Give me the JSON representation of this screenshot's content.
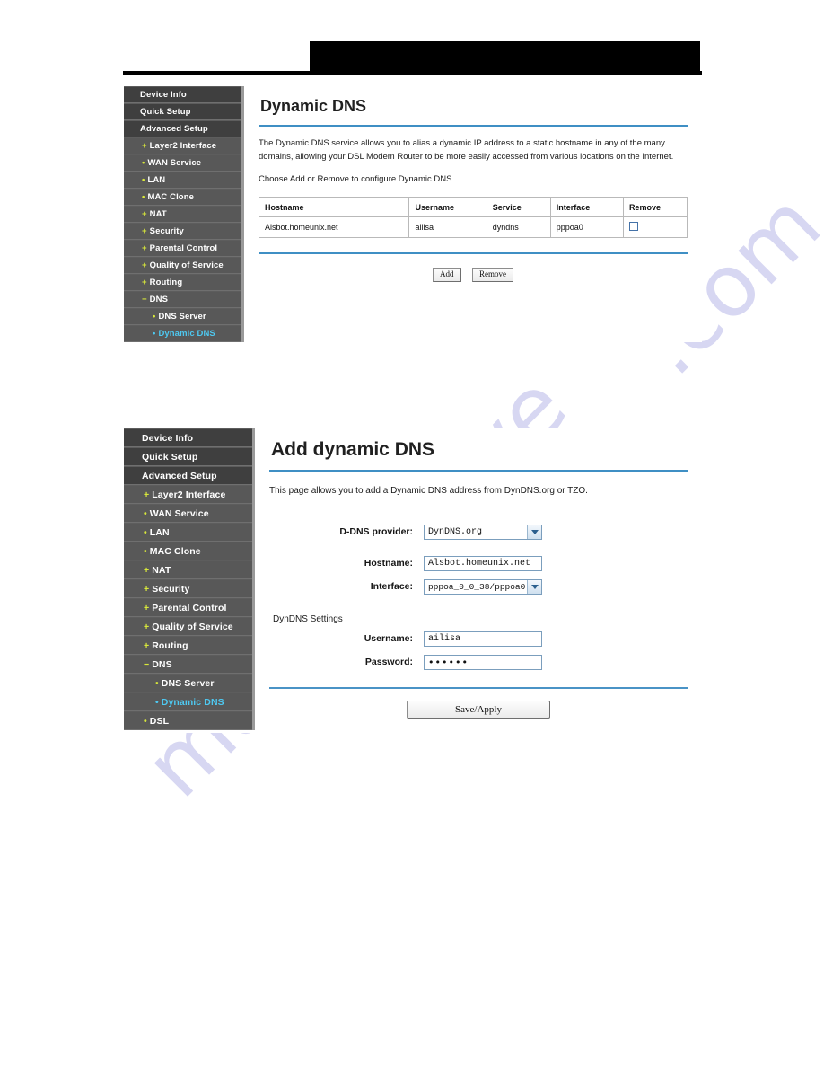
{
  "watermark": {
    "line_a": ".com",
    "line_b": "manualshive"
  },
  "header": {
    "redaction_bar": ""
  },
  "screenshot_top": {
    "sidebar": {
      "items": [
        {
          "label": "Device Info",
          "level": "top",
          "marker": "",
          "active": false
        },
        {
          "label": "Quick Setup",
          "level": "top",
          "marker": "",
          "active": false
        },
        {
          "label": "Advanced Setup",
          "level": "top",
          "marker": "",
          "active": false
        },
        {
          "label": "Layer2 Interface",
          "level": "lvl1",
          "marker": "+",
          "active": false
        },
        {
          "label": "WAN Service",
          "level": "lvl1",
          "marker": "•",
          "active": false
        },
        {
          "label": "LAN",
          "level": "lvl1",
          "marker": "•",
          "active": false
        },
        {
          "label": "MAC Clone",
          "level": "lvl1",
          "marker": "•",
          "active": false
        },
        {
          "label": "NAT",
          "level": "lvl1",
          "marker": "+",
          "active": false
        },
        {
          "label": "Security",
          "level": "lvl1",
          "marker": "+",
          "active": false
        },
        {
          "label": "Parental Control",
          "level": "lvl1",
          "marker": "+",
          "active": false
        },
        {
          "label": "Quality of Service",
          "level": "lvl1",
          "marker": "+",
          "active": false
        },
        {
          "label": "Routing",
          "level": "lvl1",
          "marker": "+",
          "active": false
        },
        {
          "label": "DNS",
          "level": "lvl1",
          "marker": "−",
          "active": false
        },
        {
          "label": "DNS Server",
          "level": "lvl2",
          "marker": "•",
          "active": false
        },
        {
          "label": "Dynamic DNS",
          "level": "lvl2",
          "marker": "•",
          "active": true
        }
      ]
    },
    "title": "Dynamic DNS",
    "paragraph_1": "The Dynamic DNS service allows you to alias a dynamic IP address to a static hostname in any of the many domains, allowing your DSL Modem Router to be more easily accessed from various locations on the Internet.",
    "paragraph_2": "Choose Add or Remove to configure Dynamic DNS.",
    "table": {
      "headers": [
        "Hostname",
        "Username",
        "Service",
        "Interface",
        "Remove"
      ],
      "rows": [
        {
          "hostname": "Alsbot.homeunix.net",
          "username": "ailisa",
          "service": "dyndns",
          "interface": "pppoa0",
          "remove_checked": false
        }
      ]
    },
    "buttons": {
      "add": "Add",
      "remove": "Remove"
    }
  },
  "screenshot_bottom": {
    "sidebar": {
      "items": [
        {
          "label": "Device Info",
          "level": "top",
          "marker": "",
          "active": false
        },
        {
          "label": "Quick Setup",
          "level": "top",
          "marker": "",
          "active": false
        },
        {
          "label": "Advanced Setup",
          "level": "top",
          "marker": "",
          "active": false
        },
        {
          "label": "Layer2 Interface",
          "level": "lvl1",
          "marker": "+",
          "active": false
        },
        {
          "label": "WAN Service",
          "level": "lvl1",
          "marker": "•",
          "active": false
        },
        {
          "label": "LAN",
          "level": "lvl1",
          "marker": "•",
          "active": false
        },
        {
          "label": "MAC Clone",
          "level": "lvl1",
          "marker": "•",
          "active": false
        },
        {
          "label": "NAT",
          "level": "lvl1",
          "marker": "+",
          "active": false
        },
        {
          "label": "Security",
          "level": "lvl1",
          "marker": "+",
          "active": false
        },
        {
          "label": "Parental Control",
          "level": "lvl1",
          "marker": "+",
          "active": false
        },
        {
          "label": "Quality of Service",
          "level": "lvl1",
          "marker": "+",
          "active": false
        },
        {
          "label": "Routing",
          "level": "lvl1",
          "marker": "+",
          "active": false
        },
        {
          "label": "DNS",
          "level": "lvl1",
          "marker": "−",
          "active": false
        },
        {
          "label": "DNS Server",
          "level": "lvl2",
          "marker": "•",
          "active": false
        },
        {
          "label": "Dynamic DNS",
          "level": "lvl2",
          "marker": "•",
          "active": true
        },
        {
          "label": "DSL",
          "level": "lvl1",
          "marker": "•",
          "active": false
        }
      ]
    },
    "title": "Add dynamic DNS",
    "paragraph_1": "This page allows you to add a Dynamic DNS address from DynDNS.org or TZO.",
    "form": {
      "provider_label": "D-DNS provider:",
      "provider_value": "DynDNS.org",
      "hostname_label": "Hostname:",
      "hostname_value": "Alsbot.homeunix.net",
      "interface_label": "Interface:",
      "interface_value": "pppoa_0_0_38/pppoa0",
      "group_label": "DynDNS Settings",
      "username_label": "Username:",
      "username_value": "ailisa",
      "password_label": "Password:",
      "password_value": "••••••"
    },
    "buttons": {
      "save_apply": "Save/Apply"
    }
  }
}
